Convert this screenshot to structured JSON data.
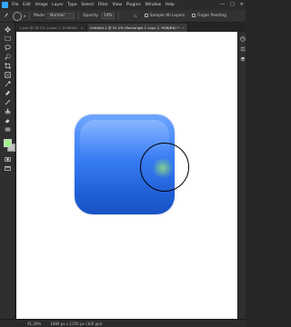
{
  "menubar": {
    "items": [
      "File",
      "Edit",
      "Image",
      "Layer",
      "Type",
      "Select",
      "Filter",
      "View",
      "Plugins",
      "Window",
      "Help"
    ],
    "window_controls": [
      "—",
      "□",
      "✕"
    ]
  },
  "options": {
    "mode_label": "Mode:",
    "mode_value": "Normal",
    "opacity_label": "Opacity:",
    "opacity_value": "14%",
    "sample_label": "Sample All Layers",
    "finger_label": "Finger Painting"
  },
  "tabs": [
    {
      "label": "1.psd @ 76.2% (Layer 1, RGB/8#)",
      "active": false
    },
    {
      "label": "Untitled-1 @ 91.2% (Rectangle 1 copy 2, RGB/8#) *",
      "active": true
    }
  ],
  "colors": {
    "foreground": "#9ff08a",
    "background": "#bdbdbd",
    "shape_top": "#6fa6ff",
    "shape_bottom": "#1a53c4"
  },
  "tools": [
    "move-icon",
    "marquee-icon",
    "lasso-icon",
    "quick-select-icon",
    "crop-icon",
    "frame-icon",
    "eyedropper-icon",
    "healing-icon",
    "brush-icon",
    "stamp-icon",
    "history-brush-icon",
    "eraser-icon",
    "gradient-icon",
    "smudge-icon",
    "dodge-icon",
    "pen-icon",
    "type-icon",
    "path-select-icon",
    "shape-icon",
    "hand-icon",
    "zoom-icon",
    "more-icon"
  ],
  "status": {
    "zoom": "91.29%",
    "doc_size": "1080 px x 1350 px (300 ppi)"
  }
}
